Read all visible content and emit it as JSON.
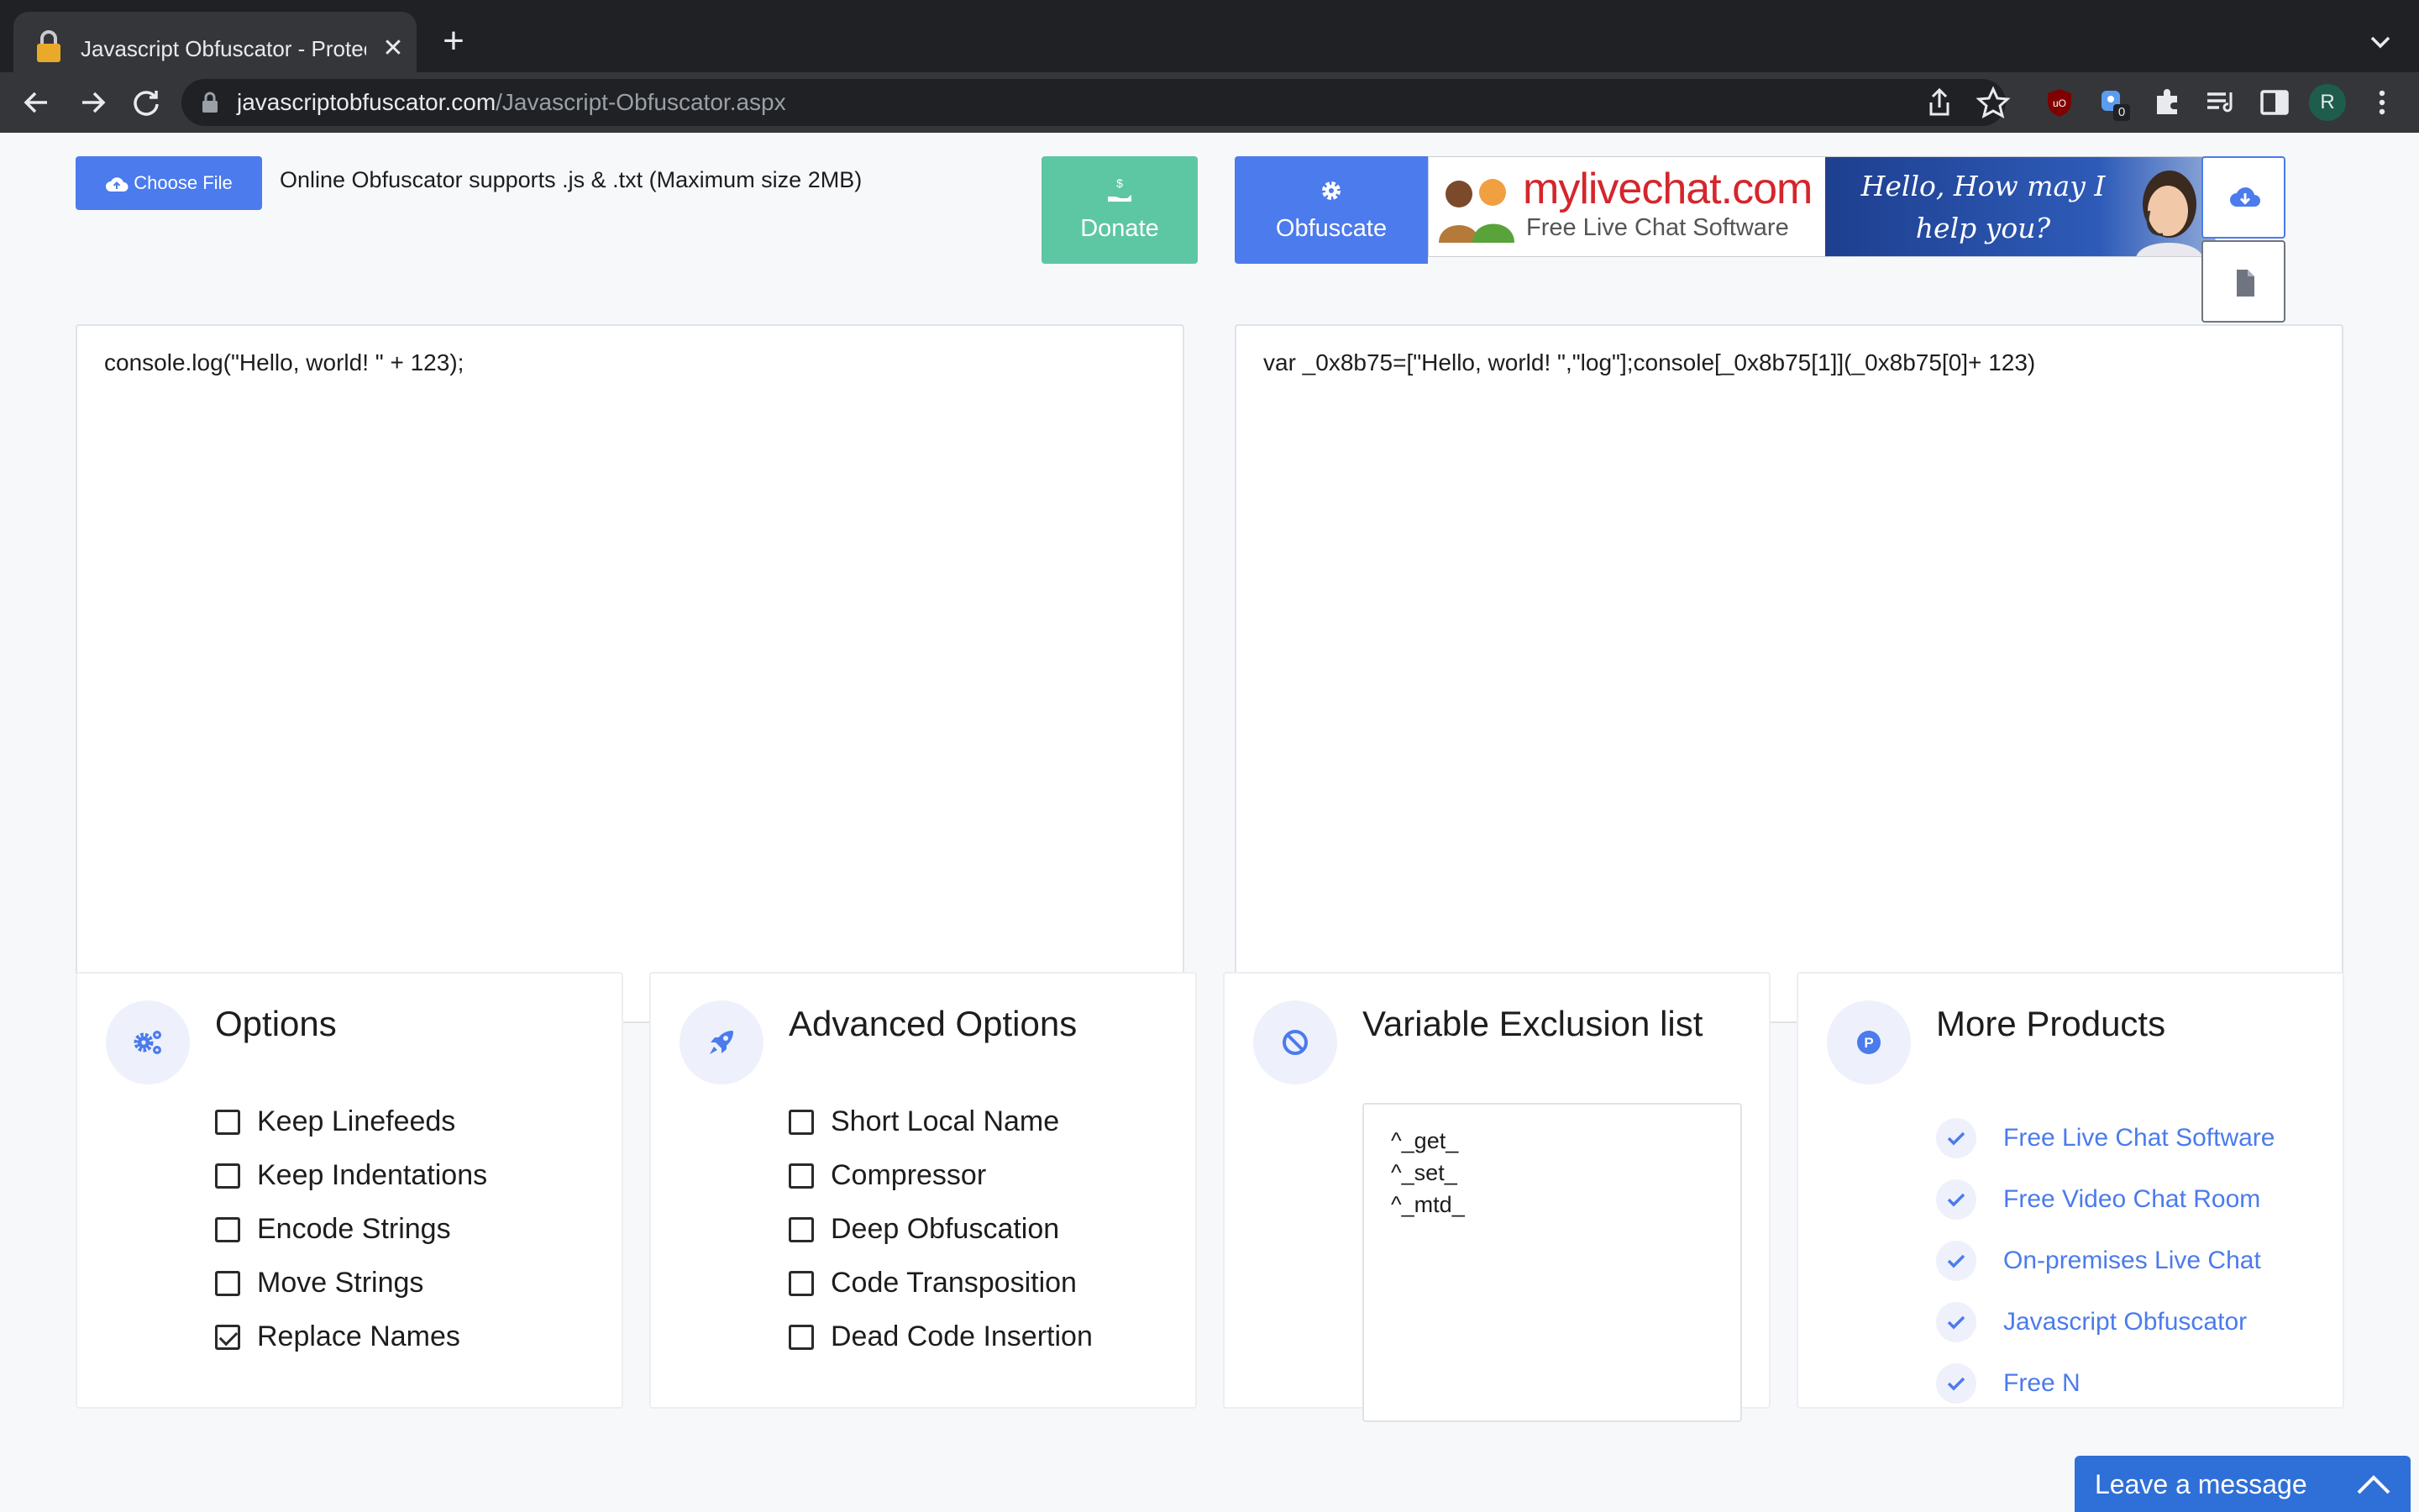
{
  "browser": {
    "tab_title": "Javascript Obfuscator - Protect",
    "new_tab_label": "+",
    "url_domain": "javascriptobfuscator.com",
    "url_path": "/Javascript-Obfuscator.aspx",
    "profile_initial": "R",
    "extension_badge": "0"
  },
  "upload": {
    "choose_file_label": "Choose File",
    "supports_text": "Online Obfuscator supports .js & .txt (Maximum size 2MB)"
  },
  "actions": {
    "donate_label": "Donate",
    "obfuscate_label": "Obfuscate"
  },
  "ad": {
    "site": "mylivechat.com",
    "subtitle": "Free Live Chat Software",
    "greeting_line1": "Hello, How may I",
    "greeting_line2": "help you?"
  },
  "input_code": "console.log(\"Hello, world! \" + 123);",
  "output_code": "var _0x8b75=[\"Hello, world! \",\"log\"];console[_0x8b75[1]](_0x8b75[0]+ 123)",
  "options": {
    "title": "Options",
    "items": [
      {
        "label": "Keep Linefeeds",
        "checked": false
      },
      {
        "label": "Keep Indentations",
        "checked": false
      },
      {
        "label": "Encode Strings",
        "checked": false
      },
      {
        "label": "Move Strings",
        "checked": false
      },
      {
        "label": "Replace Names",
        "checked": true
      }
    ]
  },
  "advanced": {
    "title": "Advanced Options",
    "items": [
      {
        "label": "Short Local Name",
        "checked": false
      },
      {
        "label": "Compressor",
        "checked": false
      },
      {
        "label": "Deep Obfuscation",
        "checked": false
      },
      {
        "label": "Code Transposition",
        "checked": false
      },
      {
        "label": "Dead Code Insertion",
        "checked": false
      }
    ]
  },
  "exclusion": {
    "title": "Variable Exclusion list",
    "lines": [
      "^_get_",
      "^_set_",
      "^_mtd_"
    ]
  },
  "products": {
    "title": "More Products",
    "items": [
      "Free Live Chat Software",
      "Free Video Chat Room",
      "On-premises Live Chat",
      "Javascript Obfuscator",
      "Free N"
    ]
  },
  "chat_widget": {
    "label": "Leave a message"
  },
  "colors": {
    "primary": "#4b7bec",
    "donate": "#5dc7a4",
    "ad_red": "#d4262c"
  }
}
